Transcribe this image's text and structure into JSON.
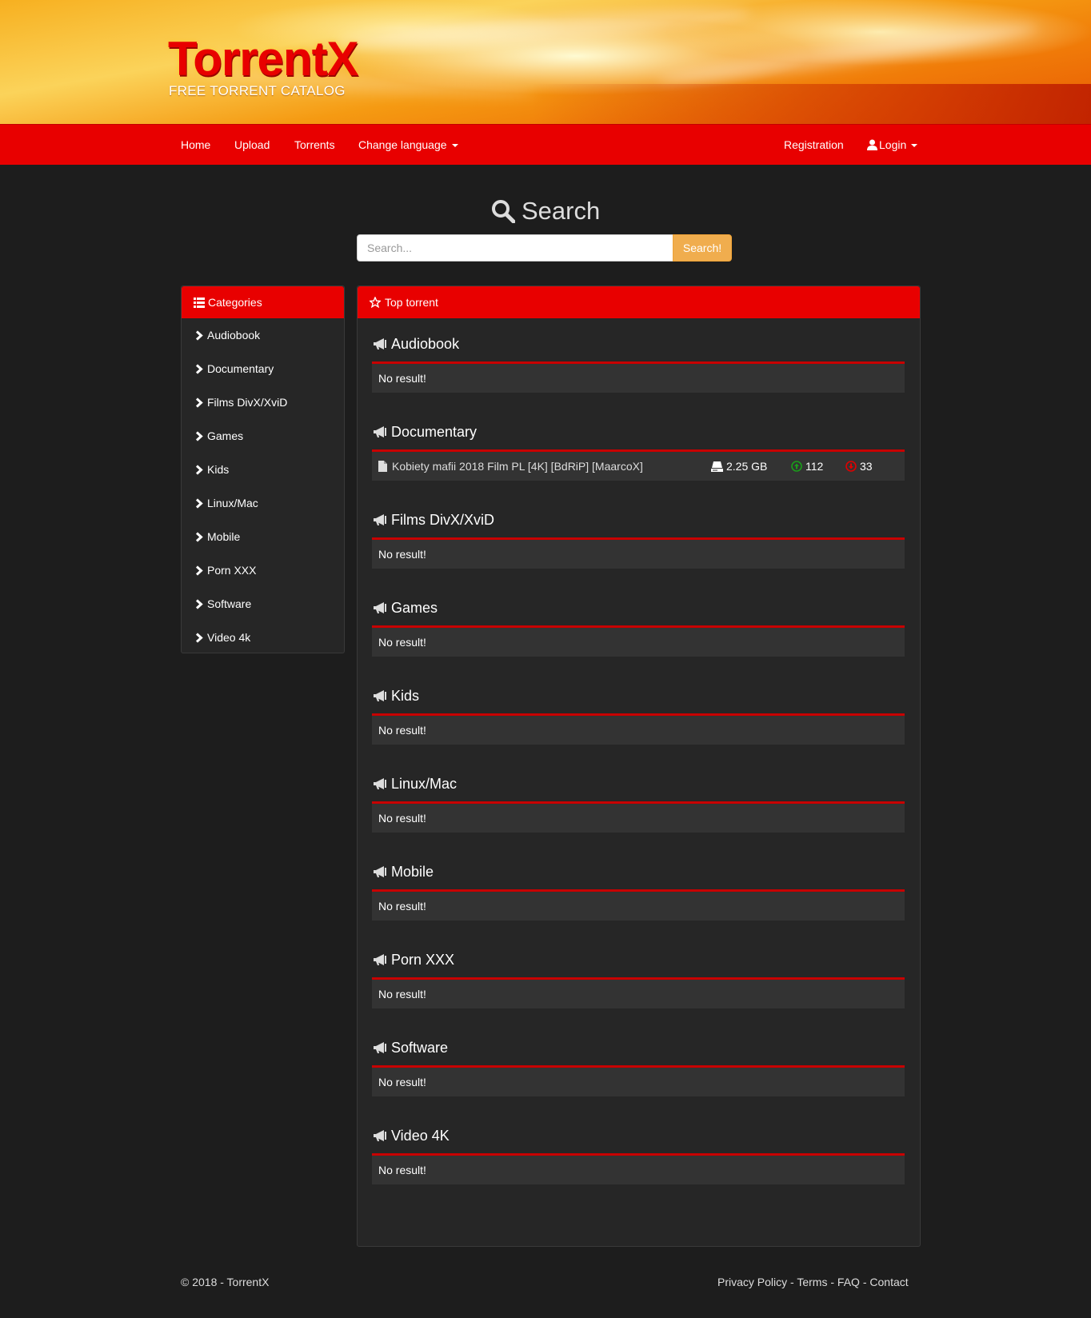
{
  "site": {
    "logo_title": "TorrentX",
    "logo_subtitle": "FREE TORRENT CATALOG",
    "brand_color": "#e80000",
    "accent_color": "#f0ad4e"
  },
  "nav": {
    "left": [
      {
        "label": "Home"
      },
      {
        "label": "Upload"
      },
      {
        "label": "Torrents"
      },
      {
        "label": "Change language"
      }
    ],
    "registration": "Registration",
    "login": "Login"
  },
  "search": {
    "heading": "Search",
    "placeholder": "Search...",
    "button": "Search!"
  },
  "categories": {
    "title": "Categories",
    "items": [
      {
        "label": "Audiobook"
      },
      {
        "label": "Documentary"
      },
      {
        "label": "Films DivX/XviD"
      },
      {
        "label": "Games"
      },
      {
        "label": "Kids"
      },
      {
        "label": "Linux/Mac"
      },
      {
        "label": "Mobile"
      },
      {
        "label": "Porn XXX"
      },
      {
        "label": "Software"
      },
      {
        "label": "Video 4k"
      }
    ]
  },
  "top_torrent": {
    "title": "Top torrent",
    "no_result": "No result!",
    "sections": [
      {
        "title": "Audiobook"
      },
      {
        "title": "Documentary",
        "torrent": {
          "name": "Kobiety mafii 2018 Film PL [4K] [BdRiP] [MaarcoX]",
          "size": "2.25 GB",
          "seeders": "112",
          "leechers": "33"
        }
      },
      {
        "title": "Films DivX/XviD"
      },
      {
        "title": "Games"
      },
      {
        "title": "Kids"
      },
      {
        "title": "Linux/Mac"
      },
      {
        "title": "Mobile"
      },
      {
        "title": "Porn XXX"
      },
      {
        "title": "Software"
      },
      {
        "title": "Video 4K"
      }
    ]
  },
  "footer": {
    "copyright": "© 2018 - TorrentX",
    "links": [
      "Privacy Policy",
      "Terms",
      "FAQ",
      "Contact"
    ],
    "separator": " - "
  }
}
